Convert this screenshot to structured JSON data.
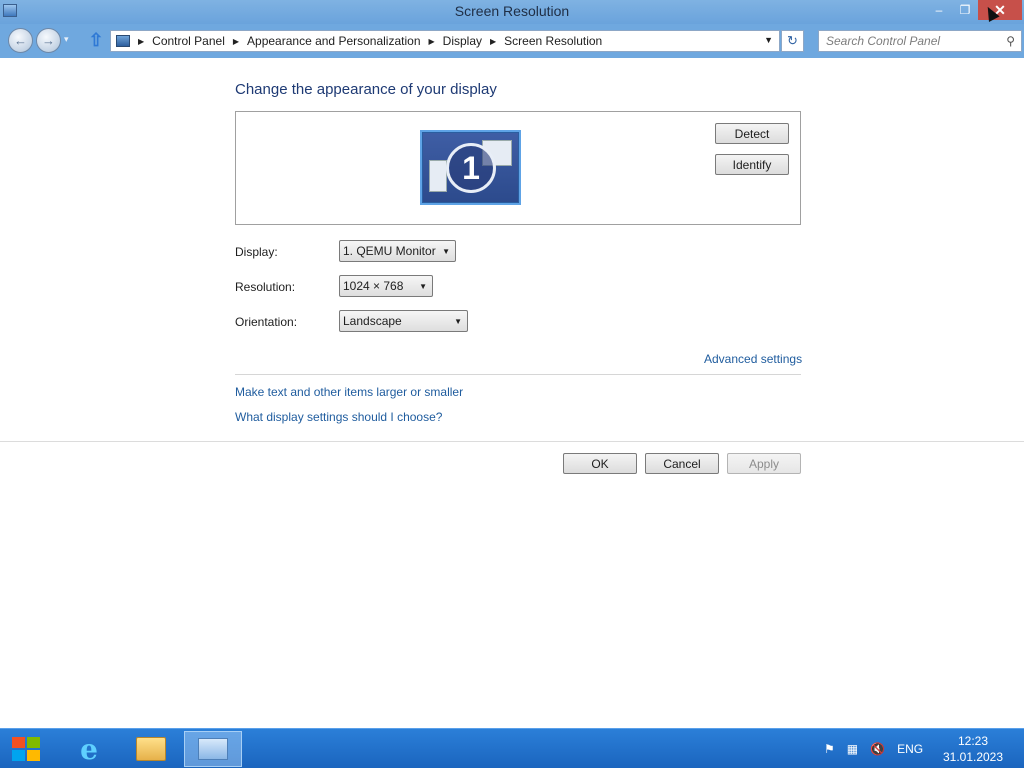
{
  "window": {
    "title": "Screen Resolution",
    "minimize_glyph": "–",
    "maximize_glyph": "❐",
    "close_glyph": "✕"
  },
  "nav": {
    "back_glyph": "←",
    "forward_glyph": "→",
    "history_glyph": "▾",
    "up_glyph": "⇧",
    "refresh_glyph": "↻",
    "breadcrumb": [
      "Control Panel",
      "Appearance and Personalization",
      "Display",
      "Screen Resolution"
    ],
    "breadcrumb_sep": "▶",
    "dropdown_glyph": "▼"
  },
  "search": {
    "placeholder": "Search Control Panel",
    "icon_glyph": "⚲"
  },
  "main": {
    "heading": "Change the appearance of your display",
    "monitor_number": "1",
    "detect_label": "Detect",
    "identify_label": "Identify",
    "display_label": "Display:",
    "display_value": "1. QEMU Monitor",
    "resolution_label": "Resolution:",
    "resolution_value": "1024 × 768",
    "orientation_label": "Orientation:",
    "orientation_value": "Landscape",
    "select_arrow": "▼",
    "advanced_link": "Advanced settings",
    "larger_link": "Make text and other items larger or smaller",
    "which_link": "What display settings should I choose?",
    "ok_label": "OK",
    "cancel_label": "Cancel",
    "apply_label": "Apply"
  },
  "taskbar": {
    "ie_glyph": "e",
    "tray": {
      "flag_glyph": "⚑",
      "network_glyph": "▦",
      "volume_glyph": "🔇",
      "language": "ENG"
    },
    "time": "12:23",
    "date": "31.01.2023"
  },
  "colors": {
    "titlebar": "#6aa3dc",
    "link": "#1f5c9e",
    "heading": "#1e3a74",
    "taskbar": "#1b65be",
    "close_button": "#c7504a"
  }
}
